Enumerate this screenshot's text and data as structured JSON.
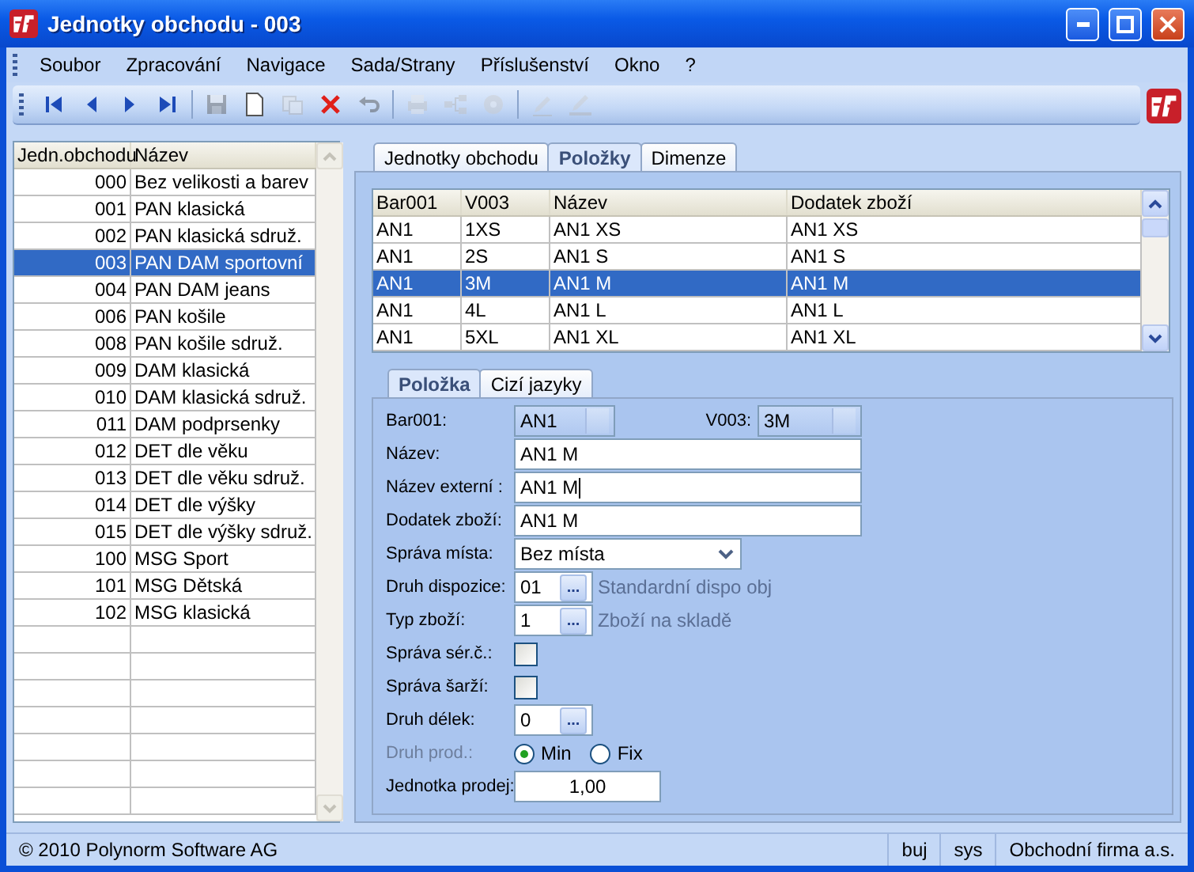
{
  "window": {
    "title": "Jednotky obchodu - 003"
  },
  "menu": [
    "Soubor",
    "Zpracování",
    "Navigace",
    "Sada/Strany",
    "Příslušenství",
    "Okno",
    "?"
  ],
  "toolbar": [
    {
      "kind": "first",
      "disabled": false
    },
    {
      "kind": "prev",
      "disabled": false
    },
    {
      "kind": "next",
      "disabled": false
    },
    {
      "kind": "last",
      "disabled": false
    },
    {
      "kind": "separator"
    },
    {
      "kind": "save",
      "disabled": true
    },
    {
      "kind": "new",
      "disabled": false
    },
    {
      "kind": "copy",
      "disabled": true
    },
    {
      "kind": "delete",
      "disabled": false
    },
    {
      "kind": "undo",
      "disabled": true
    },
    {
      "kind": "separator"
    },
    {
      "kind": "print",
      "disabled": true
    },
    {
      "kind": "tree",
      "disabled": true
    },
    {
      "kind": "disc",
      "disabled": true
    },
    {
      "kind": "separator"
    },
    {
      "kind": "pen",
      "disabled": true
    },
    {
      "kind": "penline",
      "disabled": true
    }
  ],
  "left_list": {
    "columns": [
      "Jedn.obchodu",
      "Název"
    ],
    "rows": [
      {
        "code": "000",
        "name": "Bez velikosti a barev",
        "selected": false
      },
      {
        "code": "001",
        "name": "PAN klasická",
        "selected": false
      },
      {
        "code": "002",
        "name": "PAN klasická sdruž.",
        "selected": false
      },
      {
        "code": "003",
        "name": "PAN DAM sportovní",
        "selected": true
      },
      {
        "code": "004",
        "name": "PAN DAM jeans",
        "selected": false
      },
      {
        "code": "006",
        "name": "PAN košile",
        "selected": false
      },
      {
        "code": "008",
        "name": "PAN košile sdruž.",
        "selected": false
      },
      {
        "code": "009",
        "name": "DAM klasická",
        "selected": false
      },
      {
        "code": "010",
        "name": "DAM klasická sdruž.",
        "selected": false
      },
      {
        "code": "011",
        "name": "DAM podprsenky",
        "selected": false
      },
      {
        "code": "012",
        "name": "DET dle věku",
        "selected": false
      },
      {
        "code": "013",
        "name": "DET dle věku sdruž.",
        "selected": false
      },
      {
        "code": "014",
        "name": "DET dle výšky",
        "selected": false
      },
      {
        "code": "015",
        "name": "DET dle výšky sdruž.",
        "selected": false
      },
      {
        "code": "100",
        "name": "MSG Sport",
        "selected": false
      },
      {
        "code": "101",
        "name": "MSG Dětská",
        "selected": false
      },
      {
        "code": "102",
        "name": "MSG klasická",
        "selected": false
      }
    ]
  },
  "tabs": [
    {
      "label": "Jednotky obchodu",
      "selected": false
    },
    {
      "label": "Položky",
      "selected": true
    },
    {
      "label": "Dimenze",
      "selected": false
    }
  ],
  "grid": {
    "columns": [
      "Bar001",
      "V003",
      "Název",
      "Dodatek zboží"
    ],
    "rows": [
      {
        "cells": [
          "AN1",
          "1XS",
          "AN1 XS",
          "AN1 XS"
        ],
        "selected": false
      },
      {
        "cells": [
          "AN1",
          "2S",
          "AN1 S",
          "AN1 S"
        ],
        "selected": false
      },
      {
        "cells": [
          "AN1",
          "3M",
          "AN1 M",
          "AN1 M"
        ],
        "selected": true
      },
      {
        "cells": [
          "AN1",
          "4L",
          "AN1 L",
          "AN1 L"
        ],
        "selected": false
      },
      {
        "cells": [
          "AN1",
          "5XL",
          "AN1 XL",
          "AN1 XL"
        ],
        "selected": false
      }
    ]
  },
  "subtabs": [
    {
      "label": "Položka",
      "selected": true
    },
    {
      "label": "Cizí jazyky",
      "selected": false
    }
  ],
  "form": {
    "rows": [
      {
        "kind": "lookup_pair",
        "label": "Bar001:",
        "value": "AN1",
        "label2": "V003:",
        "value2": "3M"
      },
      {
        "kind": "text",
        "label": "Název:",
        "value": "AN1 M"
      },
      {
        "kind": "text",
        "label": "Název externí :",
        "value": "AN1 M",
        "focused": true
      },
      {
        "kind": "text",
        "label": "Dodatek zboží:",
        "value": " AN1 M"
      },
      {
        "kind": "combo",
        "label": "Správa místa:",
        "value": "Bez místa"
      },
      {
        "kind": "code",
        "label": "Druh dispozice:",
        "value": "01",
        "button": "...",
        "description": "Standardní dispo obj"
      },
      {
        "kind": "code",
        "label": "Typ zboží:",
        "value": "1",
        "button": "...",
        "description": "Zboží na skladě"
      },
      {
        "kind": "checkbox",
        "label": "Správa sér.č.:",
        "checked": false
      },
      {
        "kind": "checkbox",
        "label": "Správa šarží:",
        "checked": false
      },
      {
        "kind": "code",
        "label": "Druh délek:",
        "value": "0",
        "button": "..."
      },
      {
        "kind": "radio",
        "label": "Druh prod.:",
        "disabled": true,
        "options": [
          {
            "label": "Min",
            "selected": true
          },
          {
            "label": "Fix",
            "selected": false
          }
        ]
      },
      {
        "kind": "number",
        "label": "Jednotka prodej:",
        "value": "1,00"
      }
    ]
  },
  "status_bar": [
    "© 2010 Polynorm Software AG",
    "buj",
    "sys",
    "Obchodní firma a.s."
  ]
}
